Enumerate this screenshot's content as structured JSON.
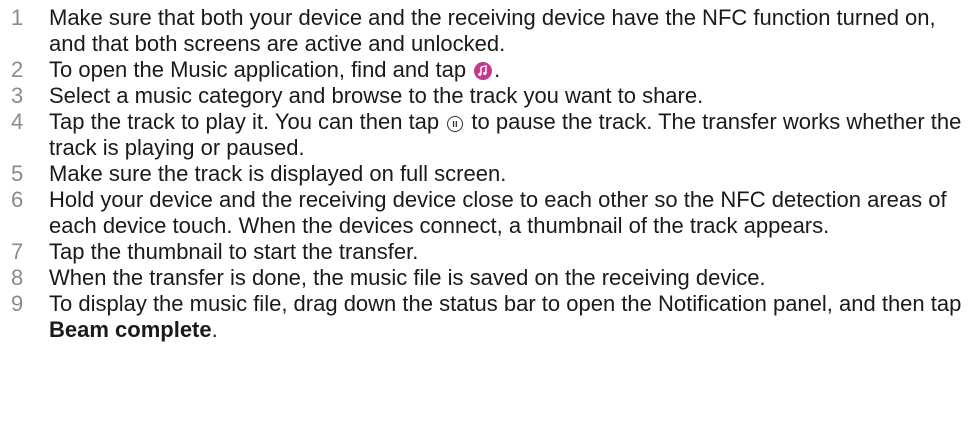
{
  "steps": [
    {
      "num": "1",
      "text": "Make sure that both your device and the receiving device have the NFC function turned on, and that both screens are active and unlocked."
    },
    {
      "num": "2",
      "text_before": "To open the Music application, find and tap ",
      "icon": "music-app-icon",
      "text_after": "."
    },
    {
      "num": "3",
      "text": "Select a music category and browse to the track you want to share."
    },
    {
      "num": "4",
      "text_before": "Tap the track to play it. You can then tap ",
      "icon": "pause-icon",
      "text_after": " to pause the track. The transfer works whether the track is playing or paused."
    },
    {
      "num": "5",
      "text": "Make sure the track is displayed on full screen."
    },
    {
      "num": "6",
      "text": "Hold your device and the receiving device close to each other so the NFC detection areas of each device touch. When the devices connect, a thumbnail of the track appears."
    },
    {
      "num": "7",
      "text": "Tap the thumbnail to start the transfer."
    },
    {
      "num": "8",
      "text": "When the transfer is done, the music file is saved on the receiving device."
    },
    {
      "num": "9",
      "text_before": "To display the music file, drag down the status bar to open the Notification panel, and then tap ",
      "bold": "Beam complete",
      "text_after": "."
    }
  ],
  "colors": {
    "step_number": "#8a8a8a",
    "text": "#1a1a1a",
    "music_icon": "#c3398c"
  }
}
